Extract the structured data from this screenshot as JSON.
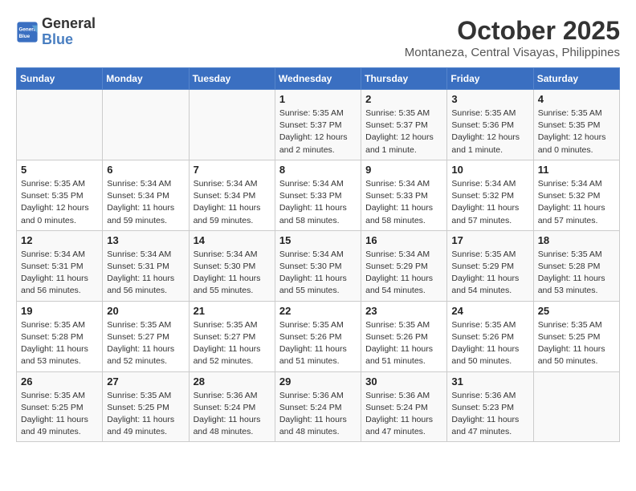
{
  "header": {
    "logo_line1": "General",
    "logo_line2": "Blue",
    "month": "October 2025",
    "location": "Montaneza, Central Visayas, Philippines"
  },
  "weekdays": [
    "Sunday",
    "Monday",
    "Tuesday",
    "Wednesday",
    "Thursday",
    "Friday",
    "Saturday"
  ],
  "weeks": [
    [
      {
        "day": "",
        "info": ""
      },
      {
        "day": "",
        "info": ""
      },
      {
        "day": "",
        "info": ""
      },
      {
        "day": "1",
        "info": "Sunrise: 5:35 AM\nSunset: 5:37 PM\nDaylight: 12 hours\nand 2 minutes."
      },
      {
        "day": "2",
        "info": "Sunrise: 5:35 AM\nSunset: 5:37 PM\nDaylight: 12 hours\nand 1 minute."
      },
      {
        "day": "3",
        "info": "Sunrise: 5:35 AM\nSunset: 5:36 PM\nDaylight: 12 hours\nand 1 minute."
      },
      {
        "day": "4",
        "info": "Sunrise: 5:35 AM\nSunset: 5:35 PM\nDaylight: 12 hours\nand 0 minutes."
      }
    ],
    [
      {
        "day": "5",
        "info": "Sunrise: 5:35 AM\nSunset: 5:35 PM\nDaylight: 12 hours\nand 0 minutes."
      },
      {
        "day": "6",
        "info": "Sunrise: 5:34 AM\nSunset: 5:34 PM\nDaylight: 11 hours\nand 59 minutes."
      },
      {
        "day": "7",
        "info": "Sunrise: 5:34 AM\nSunset: 5:34 PM\nDaylight: 11 hours\nand 59 minutes."
      },
      {
        "day": "8",
        "info": "Sunrise: 5:34 AM\nSunset: 5:33 PM\nDaylight: 11 hours\nand 58 minutes."
      },
      {
        "day": "9",
        "info": "Sunrise: 5:34 AM\nSunset: 5:33 PM\nDaylight: 11 hours\nand 58 minutes."
      },
      {
        "day": "10",
        "info": "Sunrise: 5:34 AM\nSunset: 5:32 PM\nDaylight: 11 hours\nand 57 minutes."
      },
      {
        "day": "11",
        "info": "Sunrise: 5:34 AM\nSunset: 5:32 PM\nDaylight: 11 hours\nand 57 minutes."
      }
    ],
    [
      {
        "day": "12",
        "info": "Sunrise: 5:34 AM\nSunset: 5:31 PM\nDaylight: 11 hours\nand 56 minutes."
      },
      {
        "day": "13",
        "info": "Sunrise: 5:34 AM\nSunset: 5:31 PM\nDaylight: 11 hours\nand 56 minutes."
      },
      {
        "day": "14",
        "info": "Sunrise: 5:34 AM\nSunset: 5:30 PM\nDaylight: 11 hours\nand 55 minutes."
      },
      {
        "day": "15",
        "info": "Sunrise: 5:34 AM\nSunset: 5:30 PM\nDaylight: 11 hours\nand 55 minutes."
      },
      {
        "day": "16",
        "info": "Sunrise: 5:34 AM\nSunset: 5:29 PM\nDaylight: 11 hours\nand 54 minutes."
      },
      {
        "day": "17",
        "info": "Sunrise: 5:35 AM\nSunset: 5:29 PM\nDaylight: 11 hours\nand 54 minutes."
      },
      {
        "day": "18",
        "info": "Sunrise: 5:35 AM\nSunset: 5:28 PM\nDaylight: 11 hours\nand 53 minutes."
      }
    ],
    [
      {
        "day": "19",
        "info": "Sunrise: 5:35 AM\nSunset: 5:28 PM\nDaylight: 11 hours\nand 53 minutes."
      },
      {
        "day": "20",
        "info": "Sunrise: 5:35 AM\nSunset: 5:27 PM\nDaylight: 11 hours\nand 52 minutes."
      },
      {
        "day": "21",
        "info": "Sunrise: 5:35 AM\nSunset: 5:27 PM\nDaylight: 11 hours\nand 52 minutes."
      },
      {
        "day": "22",
        "info": "Sunrise: 5:35 AM\nSunset: 5:26 PM\nDaylight: 11 hours\nand 51 minutes."
      },
      {
        "day": "23",
        "info": "Sunrise: 5:35 AM\nSunset: 5:26 PM\nDaylight: 11 hours\nand 51 minutes."
      },
      {
        "day": "24",
        "info": "Sunrise: 5:35 AM\nSunset: 5:26 PM\nDaylight: 11 hours\nand 50 minutes."
      },
      {
        "day": "25",
        "info": "Sunrise: 5:35 AM\nSunset: 5:25 PM\nDaylight: 11 hours\nand 50 minutes."
      }
    ],
    [
      {
        "day": "26",
        "info": "Sunrise: 5:35 AM\nSunset: 5:25 PM\nDaylight: 11 hours\nand 49 minutes."
      },
      {
        "day": "27",
        "info": "Sunrise: 5:35 AM\nSunset: 5:25 PM\nDaylight: 11 hours\nand 49 minutes."
      },
      {
        "day": "28",
        "info": "Sunrise: 5:36 AM\nSunset: 5:24 PM\nDaylight: 11 hours\nand 48 minutes."
      },
      {
        "day": "29",
        "info": "Sunrise: 5:36 AM\nSunset: 5:24 PM\nDaylight: 11 hours\nand 48 minutes."
      },
      {
        "day": "30",
        "info": "Sunrise: 5:36 AM\nSunset: 5:24 PM\nDaylight: 11 hours\nand 47 minutes."
      },
      {
        "day": "31",
        "info": "Sunrise: 5:36 AM\nSunset: 5:23 PM\nDaylight: 11 hours\nand 47 minutes."
      },
      {
        "day": "",
        "info": ""
      }
    ]
  ]
}
